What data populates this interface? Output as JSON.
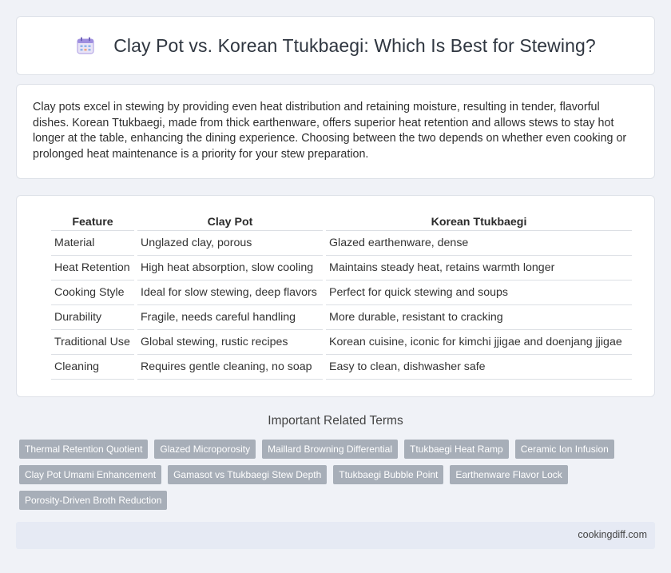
{
  "header": {
    "title": "Clay Pot vs. Korean Ttukbaegi: Which Is Best for Stewing?",
    "icon": "calendar-icon"
  },
  "intro": {
    "text": "Clay pots excel in stewing by providing even heat distribution and retaining moisture, resulting in tender, flavorful dishes. Korean Ttukbaegi, made from thick earthenware, offers superior heat retention and allows stews to stay hot longer at the table, enhancing the dining experience. Choosing between the two depends on whether even cooking or prolonged heat maintenance is a priority for your stew preparation."
  },
  "table": {
    "headers": [
      "Feature",
      "Clay Pot",
      "Korean Ttukbaegi"
    ],
    "rows": [
      [
        "Material",
        "Unglazed clay, porous",
        "Glazed earthenware, dense"
      ],
      [
        "Heat Retention",
        "High heat absorption, slow cooling",
        "Maintains steady heat, retains warmth longer"
      ],
      [
        "Cooking Style",
        "Ideal for slow stewing, deep flavors",
        "Perfect for quick stewing and soups"
      ],
      [
        "Durability",
        "Fragile, needs careful handling",
        "More durable, resistant to cracking"
      ],
      [
        "Traditional Use",
        "Global stewing, rustic recipes",
        "Korean cuisine, iconic for kimchi jjigae and doenjang jjigae"
      ],
      [
        "Cleaning",
        "Requires gentle cleaning, no soap",
        "Easy to clean, dishwasher safe"
      ]
    ]
  },
  "related": {
    "title": "Important Related Terms",
    "tags": [
      "Thermal Retention Quotient",
      "Glazed Microporosity",
      "Maillard Browning Differential",
      "Ttukbaegi Heat Ramp",
      "Ceramic Ion Infusion",
      "Clay Pot Umami Enhancement",
      "Gamasot vs Ttukbaegi Stew Depth",
      "Ttukbaegi Bubble Point",
      "Earthenware Flavor Lock",
      "Porosity-Driven Broth Reduction"
    ]
  },
  "footer": {
    "site": "cookingdiff.com"
  },
  "colors": {
    "background": "#f0f2f7",
    "tag": "#a7aeb8",
    "footer": "#e6eaf4"
  }
}
